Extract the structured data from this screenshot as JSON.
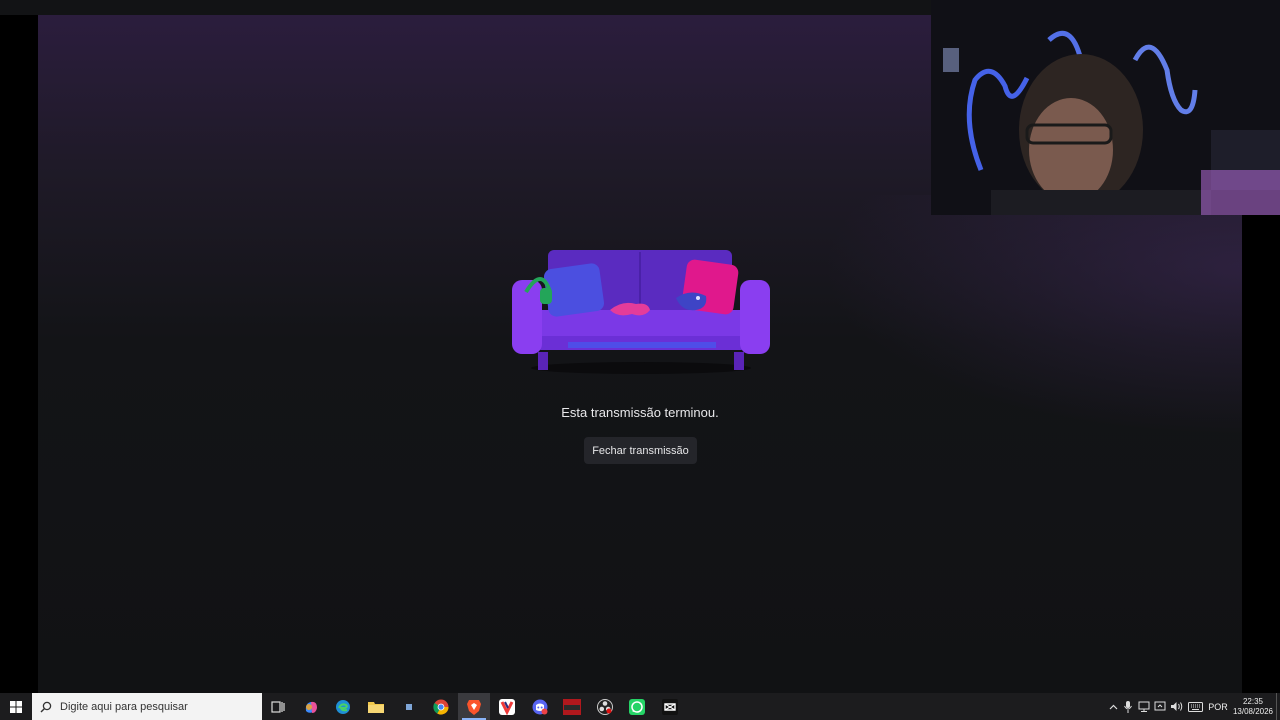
{
  "stream": {
    "ended_message": "Esta transmissão terminou.",
    "close_label": "Fechar transmissão"
  },
  "taskbar": {
    "search_placeholder": "Digite aqui para pesquisar",
    "apps": [
      {
        "name": "task-view",
        "icon": "task-view-icon"
      },
      {
        "name": "copilot",
        "icon": "copilot-icon"
      },
      {
        "name": "edge",
        "icon": "edge-icon"
      },
      {
        "name": "file-explorer",
        "icon": "folder-icon"
      },
      {
        "name": "app-small",
        "icon": "app-icon"
      },
      {
        "name": "chrome",
        "icon": "chrome-icon"
      },
      {
        "name": "brave",
        "icon": "brave-icon"
      },
      {
        "name": "vivaldi",
        "icon": "vivaldi-icon"
      },
      {
        "name": "discord",
        "icon": "discord-icon"
      },
      {
        "name": "voicemeeter",
        "icon": "voicemeeter-icon",
        "label": "VOICE\nMEETER"
      },
      {
        "name": "obs",
        "icon": "obs-icon"
      },
      {
        "name": "whatsapp",
        "icon": "whatsapp-icon"
      },
      {
        "name": "capcut",
        "icon": "capcut-icon"
      }
    ],
    "language": "POR",
    "time": "22:35",
    "date": "13/08/2026"
  },
  "colors": {
    "accent_purple": "#6a2fc9",
    "pillow_pink": "#e0188c",
    "pillow_blue": "#4b4fe0",
    "headset_green": "#23a559"
  }
}
